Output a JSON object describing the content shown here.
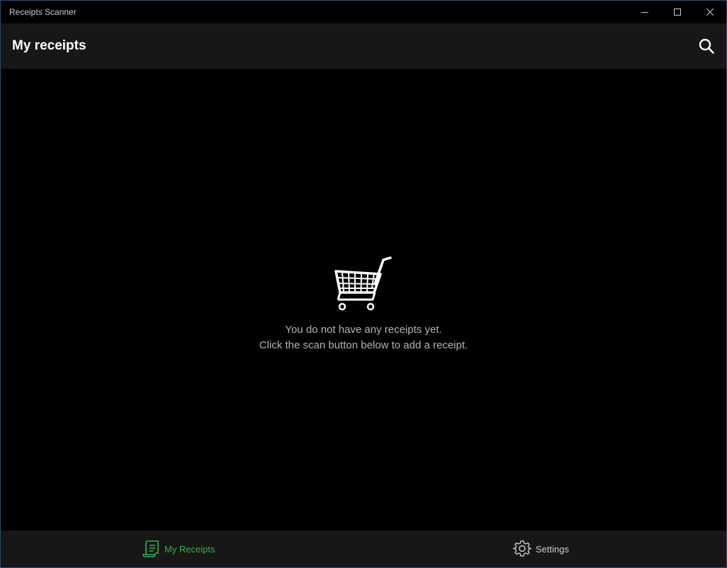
{
  "window": {
    "title": "Receipts Scanner",
    "controls": {
      "minimize_icon": "minimize-icon",
      "maximize_icon": "maximize-icon",
      "close_icon": "close-icon"
    }
  },
  "header": {
    "title": "My receipts",
    "search_icon": "search-icon"
  },
  "empty_state": {
    "icon": "shopping-cart-icon",
    "line1": "You do not have any receipts yet.",
    "line2": "Click the scan button below to add a receipt."
  },
  "bottom_nav": {
    "items": [
      {
        "label": "My Receipts",
        "icon": "receipt-icon",
        "active": true
      },
      {
        "label": "Settings",
        "icon": "gear-icon",
        "active": false
      }
    ]
  },
  "colors": {
    "accent": "#2fb34a",
    "background": "#000000",
    "bar_background": "#171717",
    "text_primary": "#ffffff",
    "text_secondary": "#b3b3b3"
  }
}
